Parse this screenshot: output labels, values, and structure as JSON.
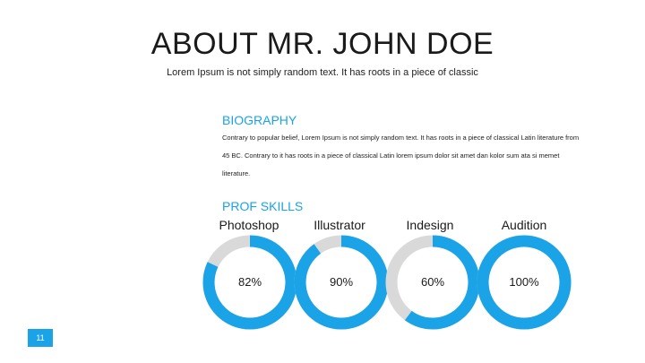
{
  "header": {
    "title": "ABOUT MR. JOHN DOE",
    "subtitle": "Lorem Ipsum is not simply random text. It has roots in a piece of classic"
  },
  "biography": {
    "heading": "BIOGRAPHY",
    "body": "Contrary to popular belief, Lorem Ipsum is not simply random text. It has roots in a piece of classical Latin literature from 45 BC. Contrary to it has roots in a piece of classical Latin lorem ipsum dolor sit amet dan kolor sum ata si memet literature."
  },
  "skills": {
    "heading": "PROF SKILLS",
    "items": [
      {
        "label": "Photoshop",
        "percent": 82,
        "percent_text": "82%"
      },
      {
        "label": "Illustrator",
        "percent": 90,
        "percent_text": "90%"
      },
      {
        "label": "Indesign",
        "percent": 60,
        "percent_text": "60%"
      },
      {
        "label": "Audition",
        "percent": 100,
        "percent_text": "100%"
      }
    ]
  },
  "colors": {
    "accent": "#1aa3e6",
    "track": "#d9d9d9"
  },
  "footer": {
    "page_number": "11"
  }
}
